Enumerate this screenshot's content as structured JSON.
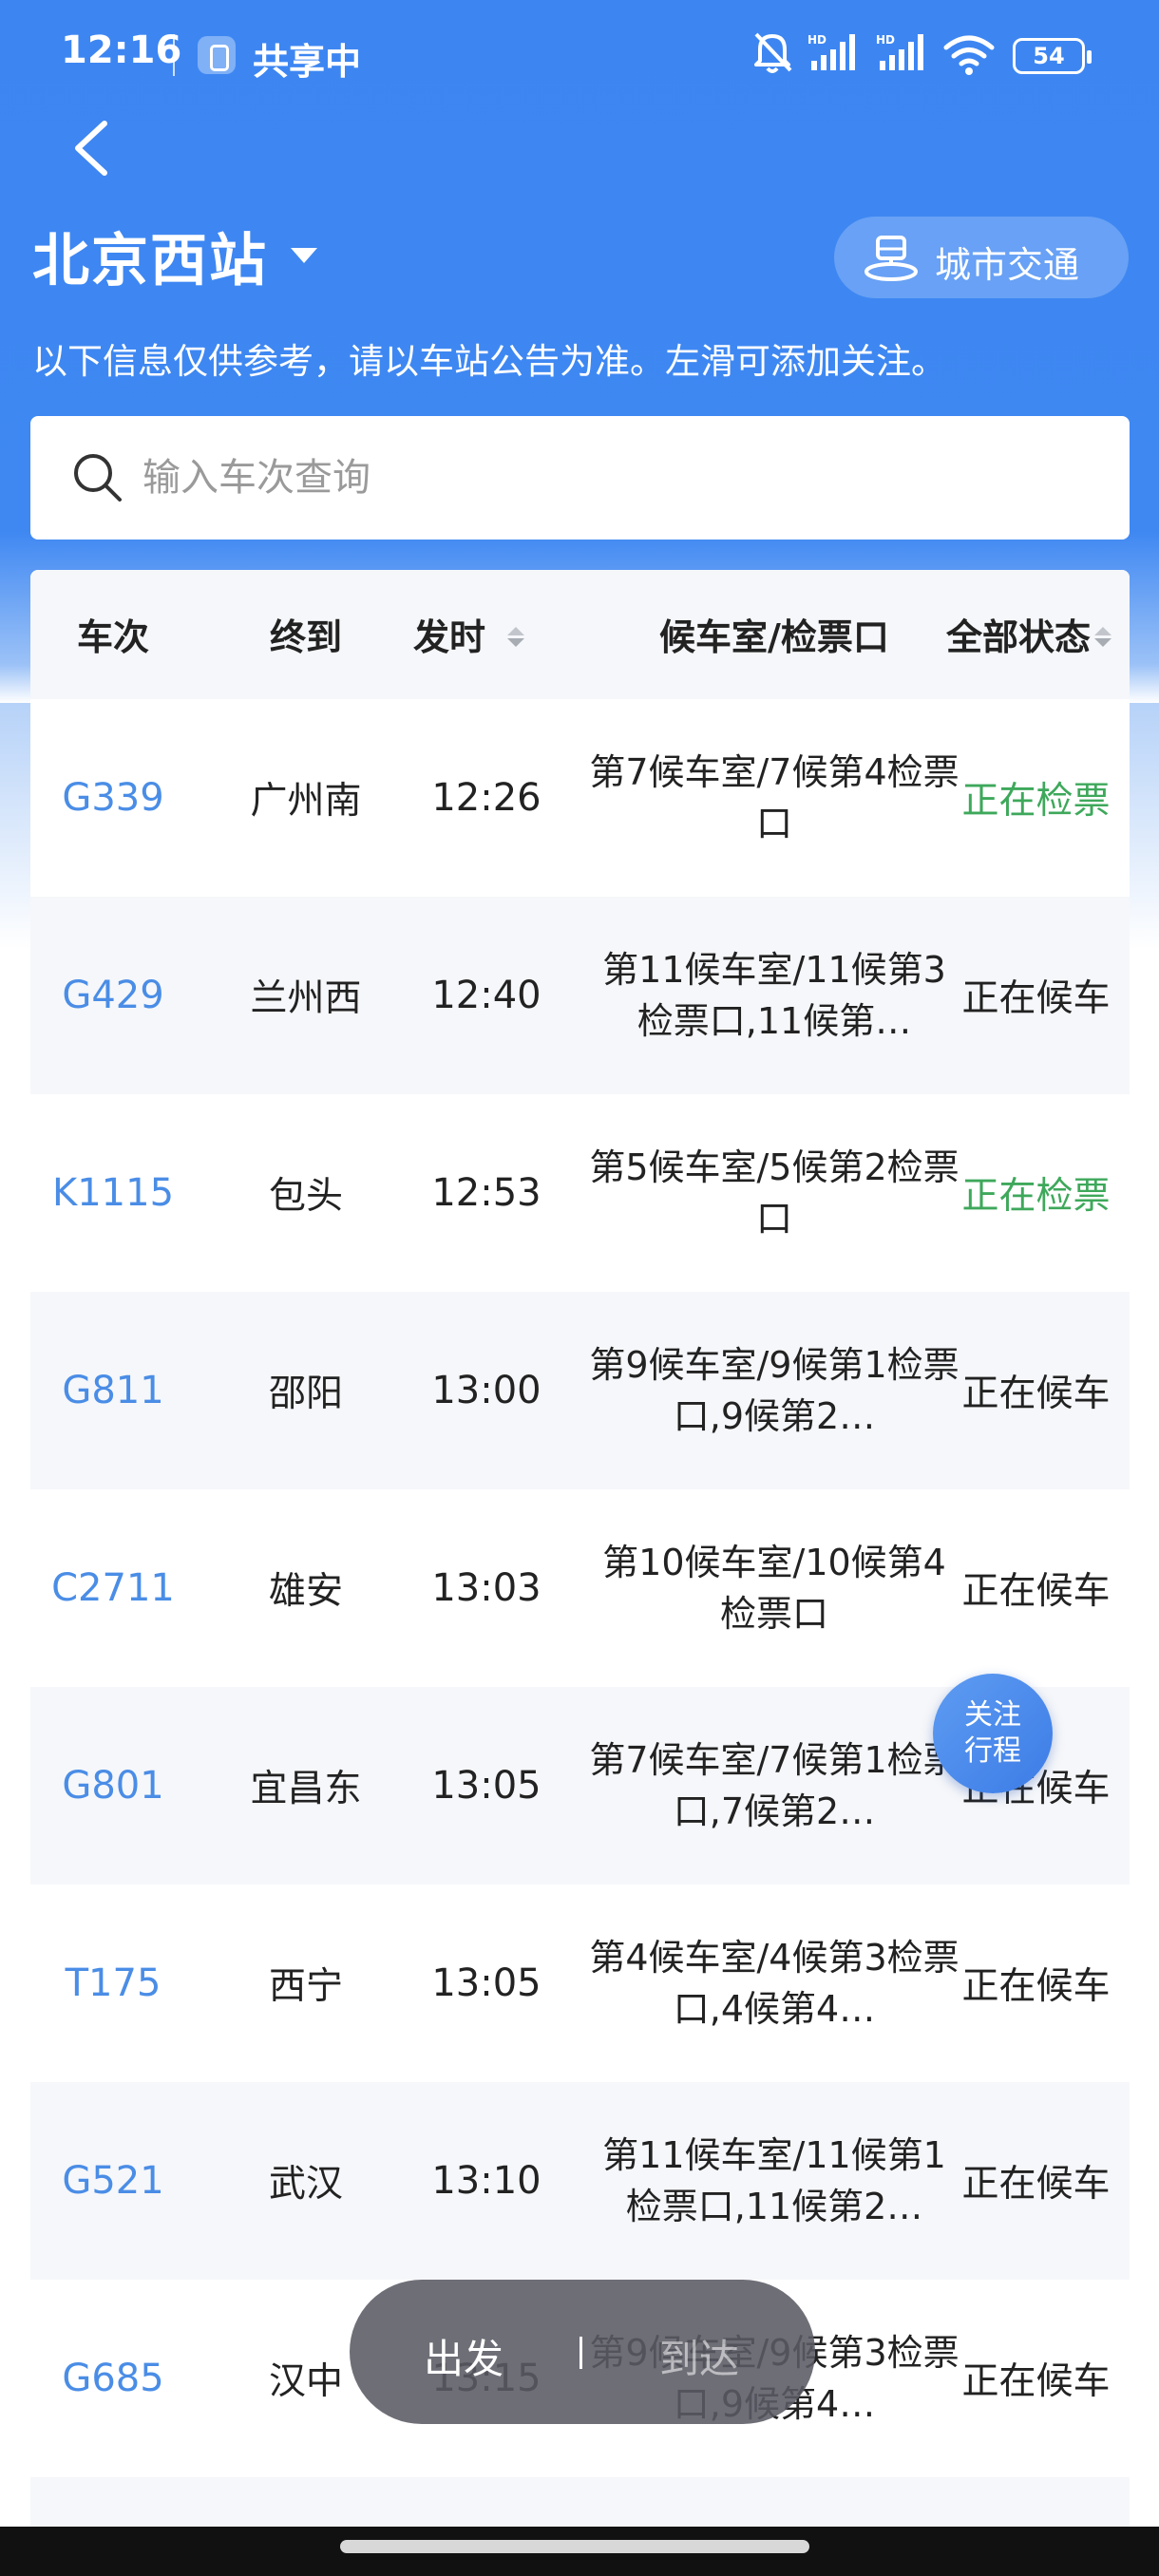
{
  "status_bar": {
    "time": "12:16",
    "share_text": "共享中",
    "battery": "54"
  },
  "header": {
    "station": "北京西站",
    "city_transport": "城市交通",
    "notice": "以下信息仅供参考，请以车站公告为准。左滑可添加关注。"
  },
  "search": {
    "placeholder": "输入车次查询"
  },
  "table": {
    "columns": {
      "train": "车次",
      "destination": "终到",
      "depart_time": "发时",
      "waiting_room": "候车室/检票口",
      "status": "全部状态"
    },
    "rows": [
      {
        "train": "G339",
        "destination": "广州南",
        "time": "12:26",
        "room": "第7候车室/7候第4检票口",
        "status": "正在检票",
        "status_color": "#3ea85b"
      },
      {
        "train": "G429",
        "destination": "兰州西",
        "time": "12:40",
        "room": "第11候车室/11候第3检票口,11候第…",
        "status": "正在候车",
        "status_color": "#222222"
      },
      {
        "train": "K1115",
        "destination": "包头",
        "time": "12:53",
        "room": "第5候车室/5候第2检票口",
        "status": "正在检票",
        "status_color": "#3ea85b"
      },
      {
        "train": "G811",
        "destination": "邵阳",
        "time": "13:00",
        "room": "第9候车室/9候第1检票口,9候第2…",
        "status": "正在候车",
        "status_color": "#222222"
      },
      {
        "train": "C2711",
        "destination": "雄安",
        "time": "13:03",
        "room": "第10候车室/10候第4检票口",
        "status": "正在候车",
        "status_color": "#222222"
      },
      {
        "train": "G801",
        "destination": "宜昌东",
        "time": "13:05",
        "room": "第7候车室/7候第1检票口,7候第2…",
        "status": "正在候车",
        "status_color": "#222222"
      },
      {
        "train": "T175",
        "destination": "西宁",
        "time": "13:05",
        "room": "第4候车室/4候第3检票口,4候第4…",
        "status": "正在候车",
        "status_color": "#222222"
      },
      {
        "train": "G521",
        "destination": "武汉",
        "time": "13:10",
        "room": "第11候车室/11候第1检票口,11候第2…",
        "status": "正在候车",
        "status_color": "#222222"
      },
      {
        "train": "G685",
        "destination": "汉中",
        "time": "13:15",
        "room": "第9候车室/9候第3检票口,9候第4…",
        "status": "正在候车",
        "status_color": "#222222"
      }
    ]
  },
  "follow_button": "关注行程",
  "toggle": {
    "departure": "出发",
    "arrival": "到达"
  }
}
